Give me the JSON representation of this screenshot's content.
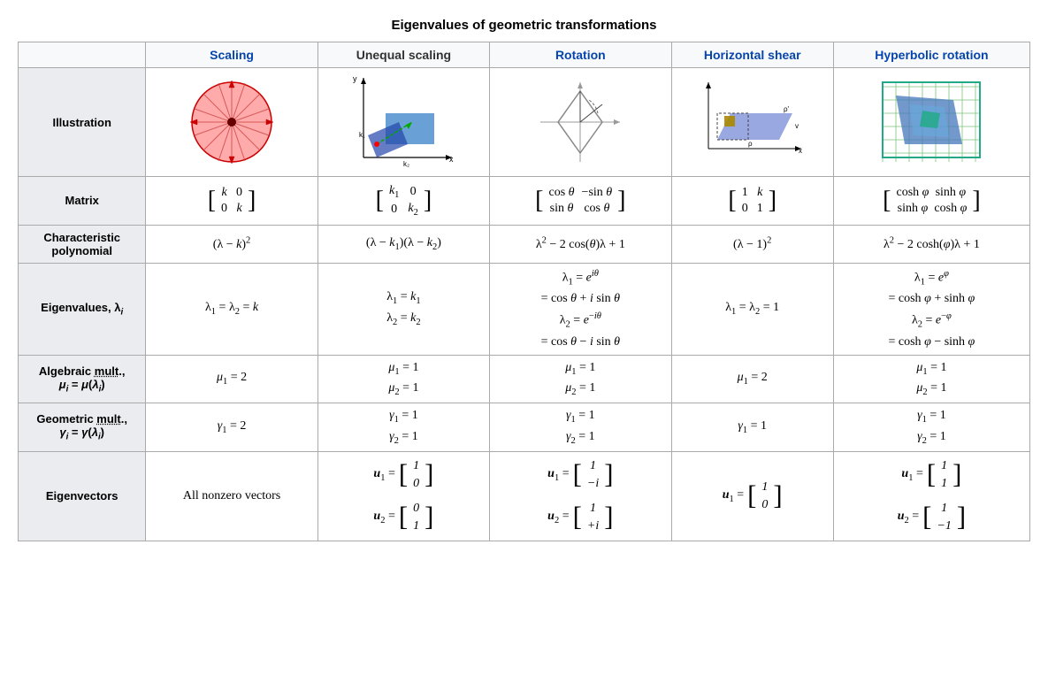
{
  "title": "Eigenvalues of geometric transformations",
  "columns": {
    "row_header": "",
    "scaling": "Scaling",
    "unequal": "Unequal scaling",
    "rotation": "Rotation",
    "hshear": "Horizontal shear",
    "hyperbolic": "Hyperbolic rotation"
  },
  "rows": {
    "illustration": "Illustration",
    "matrix": "Matrix",
    "char_poly": {
      "line1": "Characteristic",
      "line2": "polynomial"
    },
    "eigenvalues": "Eigenvalues, λᵢ",
    "alg_mult": {
      "line1": "Algebraic mult.,",
      "line2": "μᵢ = μ(λᵢ)"
    },
    "geo_mult": {
      "line1": "Geometric mult.,",
      "line2": "γᵢ = γ(λᵢ)"
    },
    "eigenvectors": "Eigenvectors"
  }
}
